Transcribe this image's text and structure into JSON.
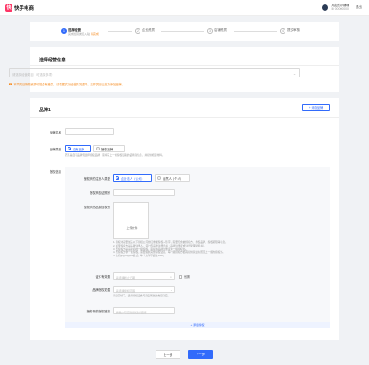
{
  "header": {
    "logo_mark": "快",
    "logo_text": "快手电商",
    "user_name": "用友的小铺哦",
    "user_id": "ID 00000000",
    "logout": "退出"
  },
  "steps": [
    {
      "num": "1",
      "title": "选择经营",
      "desc": "完成经营类目入驻",
      "desc_link": "待完成"
    },
    {
      "num": "2",
      "title": "企业资质"
    },
    {
      "num": "3",
      "title": "店铺资质"
    },
    {
      "num": "4",
      "title": "提交审核"
    }
  ],
  "category_section": {
    "title": "选择经营信息",
    "select_placeholder": "请选择经营类目（可选择多项）",
    "notice": "不同类目所需资质可能会有差异，请根据实际经营情况选择，选择类目后支持添加品牌。"
  },
  "brand": {
    "title": "品牌1",
    "add_brand": "+ 添加品牌",
    "name_label": "品牌名称",
    "type_label": "品牌类型",
    "type_options": [
      "自有品牌",
      "授权品牌"
    ],
    "type_hint": "若不是自有品牌则选择授权品牌，需填写上一级授权链路的品牌商信息，并提供相应材料。",
    "auth_label": "授权信息",
    "subject_type_label": "授权商的注册人类型",
    "subject_options": [
      "企业法人（公司）",
      "自然人（个人）"
    ],
    "id_label": "授权商的证照号",
    "doc_label": "授权商的品牌授权书",
    "upload_text": "上传文件",
    "doc_rules": [
      "1. 授权书需要加盖以下授权公司的红章或授权人签字，需要包含被授权方、授权品牌、授权期限等信息。",
      "2. 如果授权方是品牌注册人，需上传品牌注册证书（品牌注册证或注册受理通知书）。",
      "3. 若授权方是品牌商的一级授权，需提供品牌注册证和一级授权书。",
      "4. 若授权方非一级授权，需要提供完整授权链路，每一级授权方都需提供营业执照及上一级的授权书。",
      "5. 支持jpg/png/pdf格式，单个文件不超过10M。"
    ],
    "valid_label": "证件有效期",
    "date_placeholder": "请选择截止日期",
    "long_term": "长期",
    "scope_label": "品牌授权范围",
    "scope_placeholder": "请选择授权范围",
    "scope_hint": "请如实填写，选择授权品类与商品所属的类目对应。",
    "link_label": "授权书的授权链接",
    "link_placeholder": "请输入可查验授权的链接",
    "add_auth": "+ 添加授权"
  },
  "footer": {
    "prev": "上一步",
    "next": "下一步"
  }
}
